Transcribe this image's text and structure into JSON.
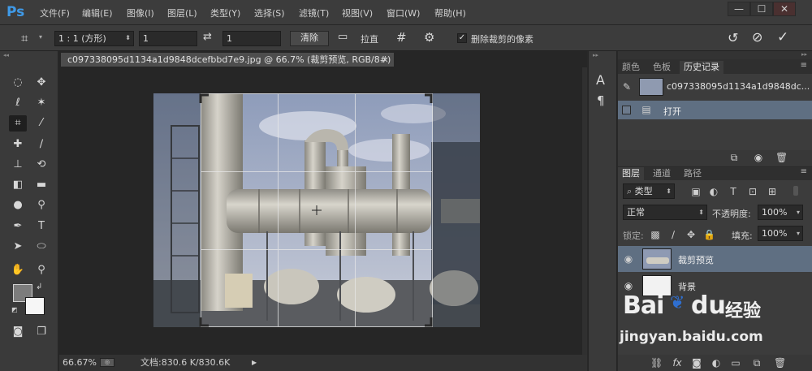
{
  "app": {
    "logo": "Ps",
    "menu": [
      "文件(F)",
      "编辑(E)",
      "图像(I)",
      "图层(L)",
      "类型(Y)",
      "选择(S)",
      "滤镜(T)",
      "视图(V)",
      "窗口(W)",
      "帮助(H)"
    ],
    "window_buttons": [
      "—",
      "☐",
      "✕"
    ]
  },
  "options": {
    "ratio_preset": "1 : 1 (方形)",
    "width_value": "1",
    "height_value": "1",
    "clear_label": "清除",
    "straighten_label": "拉直",
    "delete_cropped_checked": true,
    "delete_cropped_label": "删除裁剪的像素"
  },
  "document": {
    "tab_title": "c097338095d1134a1d9848dcefbbd7e9.jpg @ 66.7% (裁剪预览, RGB/8#)",
    "zoom": "66.67%",
    "doc_size": "文档:830.6 K/830.6K"
  },
  "history_panel": {
    "tabs": [
      "颜色",
      "色板",
      "历史记录"
    ],
    "snapshot_name": "c097338095d1134a1d9848dc...",
    "states": [
      "打开"
    ]
  },
  "layers_panel": {
    "tabs": [
      "图层",
      "通道",
      "路径"
    ],
    "filter_kind": "类型",
    "blend_mode": "正常",
    "opacity_label": "不透明度:",
    "opacity_value": "100%",
    "lock_label": "锁定:",
    "fill_label": "填充:",
    "fill_value": "100%",
    "layers": [
      {
        "name": "裁剪预览",
        "visible": true,
        "selected": true
      },
      {
        "name": "背景",
        "visible": true,
        "selected": false
      }
    ]
  },
  "watermark": {
    "brand": "Bai",
    "brand_suffix": "du",
    "product": "经验",
    "url": "jingyan.baidu.com"
  },
  "colors": {
    "accent": "#3f9ae8",
    "selection": "#5f6f82",
    "ui_dark": "#282828"
  }
}
